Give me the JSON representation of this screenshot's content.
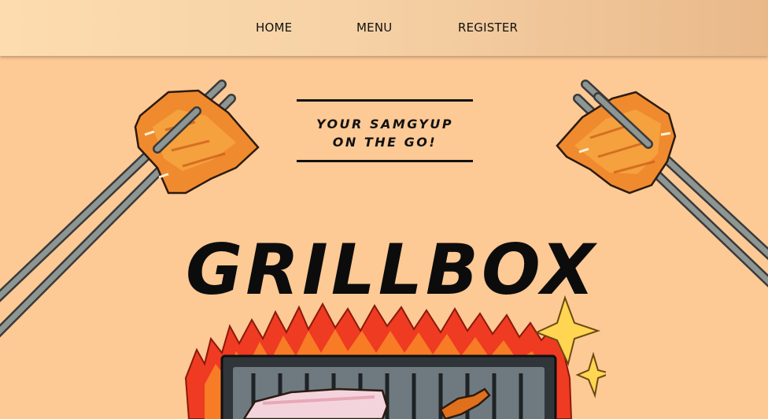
{
  "nav": {
    "home_label": "HOME",
    "menu_label": "MENU",
    "register_label": "REGISTER"
  },
  "hero": {
    "tagline_line1": "YOUR SAMGYUP",
    "tagline_line2": "ON THE GO!",
    "brand_name": "GRILLBOX"
  },
  "colors": {
    "background": "#fdc995",
    "navbar_start": "#fddcb0",
    "navbar_end": "#e9b98a",
    "text": "#111111"
  },
  "icons": {
    "left_illustration": "chopsticks-meat-icon",
    "right_illustration": "chopsticks-meat-icon",
    "bottom_illustration": "grill-icon"
  }
}
